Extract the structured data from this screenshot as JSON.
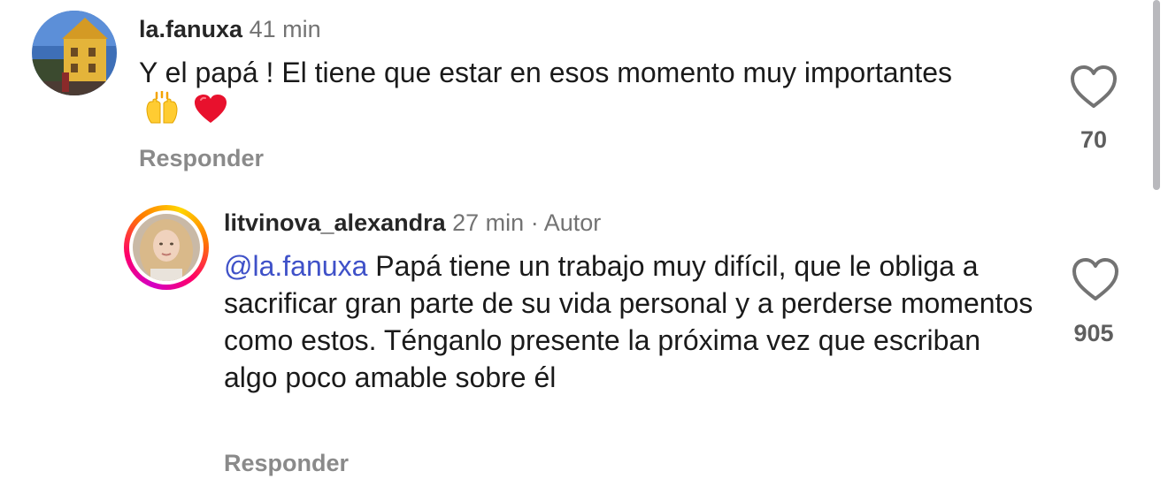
{
  "comments": [
    {
      "username": "la.fanuxa",
      "time": "41 min",
      "text": "Y el papá ! El tiene que estar en esos momento muy importantes",
      "emojis": [
        "raising-hands-icon",
        "red-heart-icon"
      ],
      "reply_label": "Responder",
      "like_count": "70"
    },
    {
      "username": "litvinova_alexandra",
      "time": "27 min",
      "separator": "·",
      "author_tag": "Autor",
      "mention": "@la.fanuxa",
      "text": "Papá tiene un trabajo muy difícil, que le obliga a sacrificar gran parte de su vida personal y a perderse momentos como estos. Ténganlo presente la próxima vez que escriban algo poco amable sobre él",
      "reply_label": "Responder",
      "like_count": "905"
    }
  ],
  "colors": {
    "mention": "#3f51c8",
    "meta_gray": "#737373",
    "heart_outline": "#737373",
    "heart_emoji": "#e8112d",
    "story_ring": [
      "#d300c5",
      "#ff0069",
      "#ff7a00",
      "#ffd600"
    ]
  }
}
